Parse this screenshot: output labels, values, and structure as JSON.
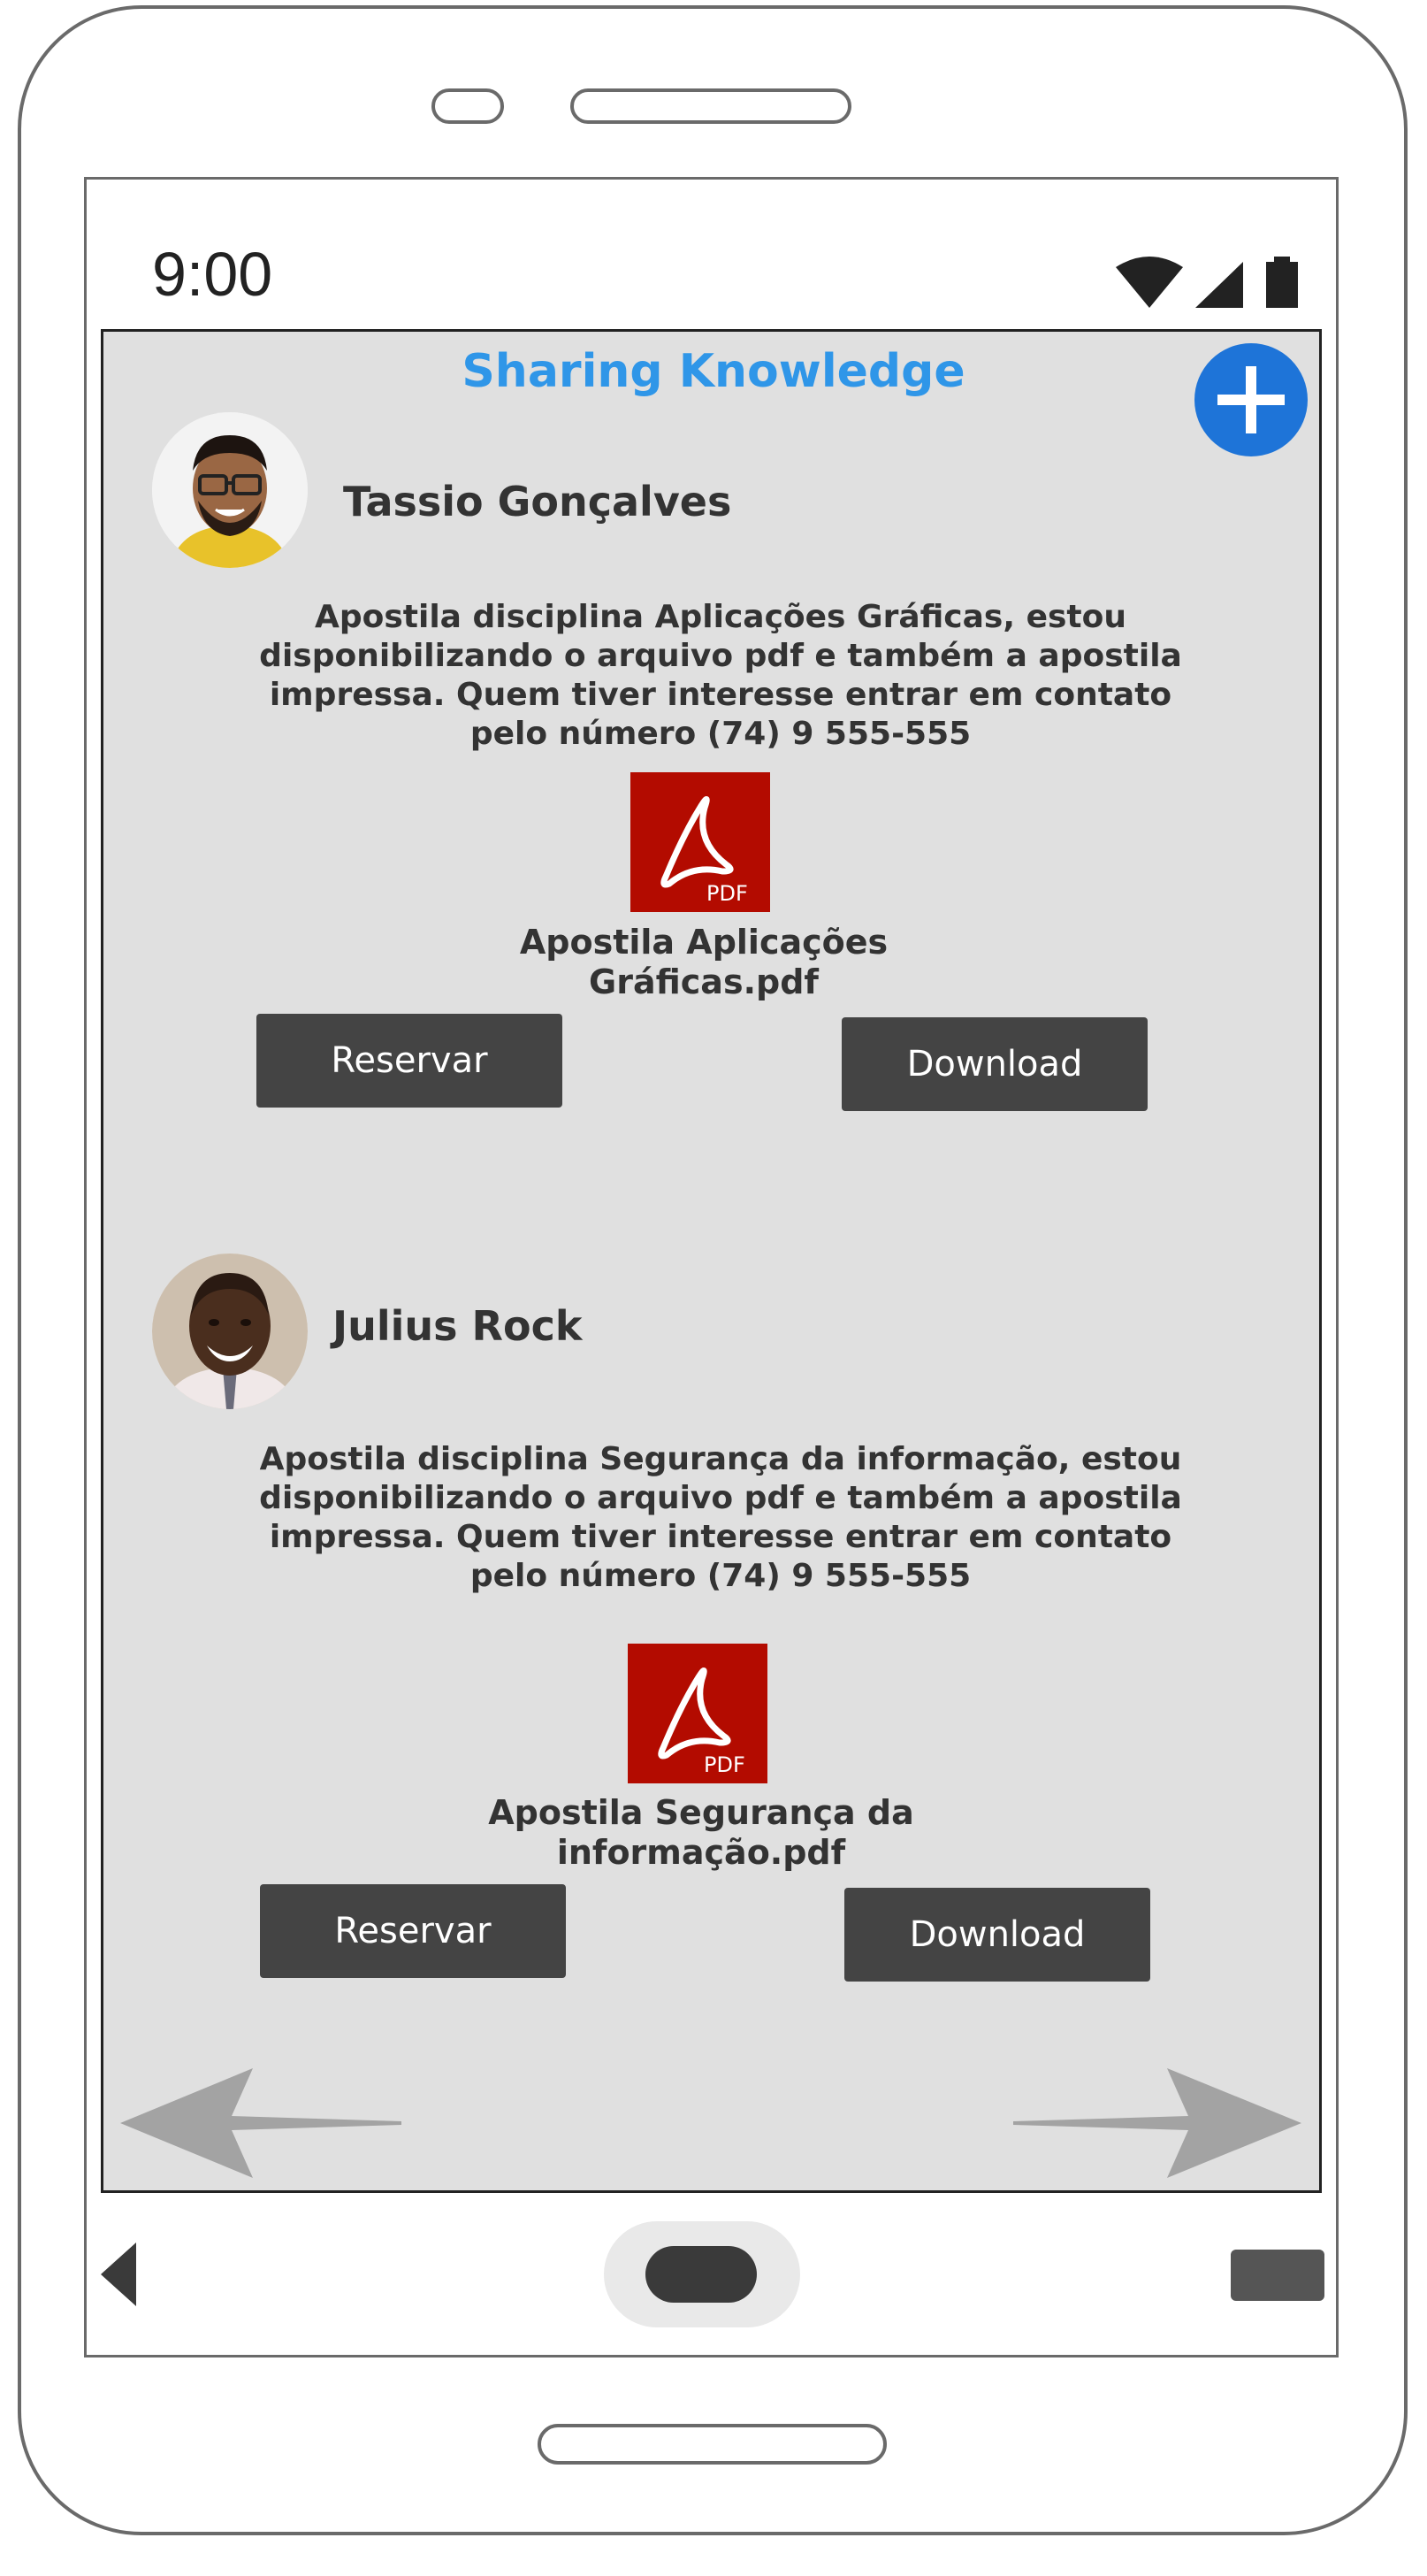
{
  "status_bar": {
    "time": "9:00",
    "icons": [
      "wifi-icon",
      "signal-icon",
      "battery-icon"
    ]
  },
  "app": {
    "title": "Sharing Knowledge",
    "add_icon": "plus-icon",
    "accent_color": "#2f96e8",
    "fab_color": "#1e74d8"
  },
  "posts": [
    {
      "author": "Tassio Gonçalves",
      "description": "Apostila disciplina Aplicações Gráficas, estou disponibilizando o arquivo pdf e também a apostila impressa. Quem tiver interesse entrar em contato pelo número (74) 9 555-555",
      "file_icon": "pdf-icon",
      "file_name": "Apostila Aplicações Gráficas.pdf",
      "reserve_label": "Reservar",
      "download_label": "Download"
    },
    {
      "author": "Julius Rock",
      "description": "Apostila disciplina Segurança da informação, estou disponibilizando o arquivo pdf e também a apostila impressa. Quem tiver interesse entrar em contato pelo número (74) 9 555-555",
      "file_icon": "pdf-icon",
      "file_name": "Apostila Segurança da informação.pdf",
      "reserve_label": "Reservar",
      "download_label": "Download"
    }
  ],
  "pager": {
    "prev_icon": "arrow-left-icon",
    "next_icon": "arrow-right-icon"
  },
  "nav_bar": {
    "icons": [
      "back-icon",
      "home-icon",
      "recent-apps-icon"
    ]
  },
  "colors": {
    "content_background": "#e0e0e0",
    "button_background": "#444444",
    "pdf_red": "#b30b00"
  }
}
